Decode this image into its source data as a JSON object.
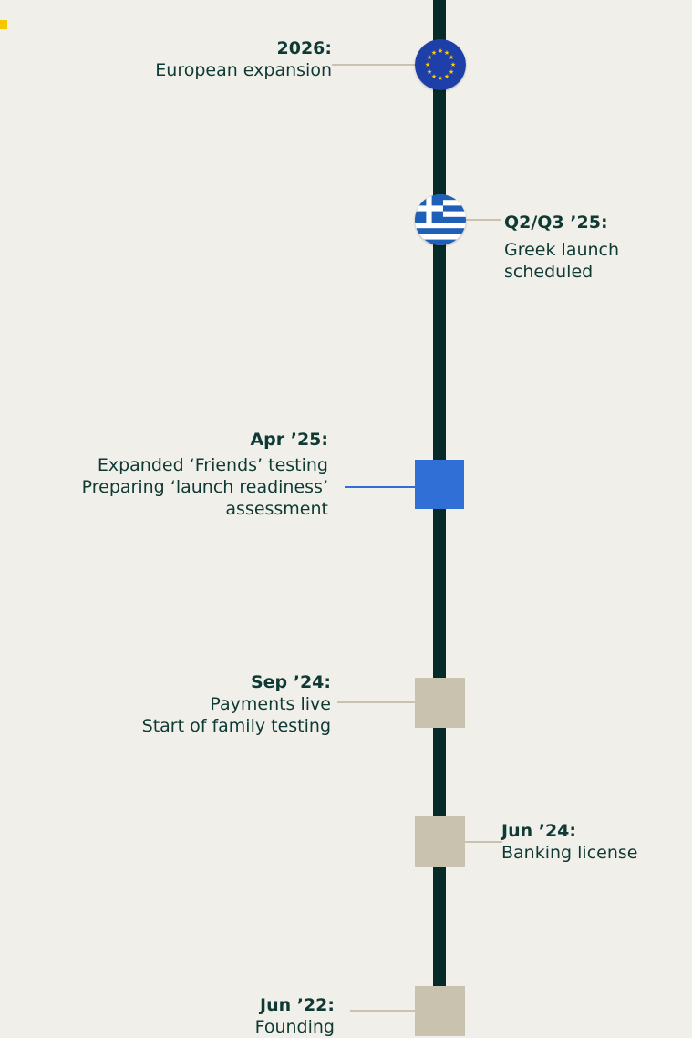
{
  "colors": {
    "background": "#f1efea",
    "spine": "#062a27",
    "text": "#0f3a34",
    "milestone_past": "#c9c2ae",
    "milestone_current": "#2f6fd6",
    "accent_corner": "#f7c800"
  },
  "milestones": [
    {
      "date": "2026:",
      "lines": [
        "European expansion"
      ],
      "marker": "eu-flag-icon"
    },
    {
      "date": "Q2/Q3 ’25:",
      "lines": [
        "Greek launch",
        "scheduled"
      ],
      "marker": "greece-flag-icon"
    },
    {
      "date": "Apr ’25:",
      "lines": [
        "Expanded ‘Friends’ testing",
        "Preparing ‘launch readiness’",
        "assessment"
      ],
      "marker": "current-square"
    },
    {
      "date": "Sep ’24:",
      "lines": [
        "Payments live",
        "Start of family testing"
      ],
      "marker": "past-square"
    },
    {
      "date": "Jun ’24:",
      "lines": [
        "Banking license"
      ],
      "marker": "past-square"
    },
    {
      "date": "Jun ’22:",
      "lines": [
        "Founding"
      ],
      "marker": "past-square"
    }
  ]
}
